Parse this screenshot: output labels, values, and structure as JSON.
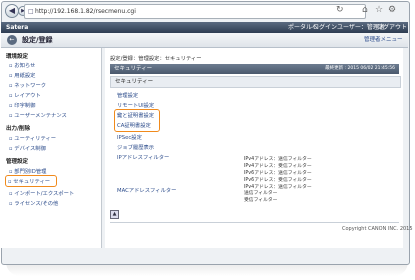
{
  "browser": {
    "url": "http://192.168.1.82/rsecmenu.cgi"
  },
  "topbar": {
    "brand": "Satera",
    "portal": "ポータルへ",
    "login_user": "ログインユーザー：管理者",
    "logout": "ログアウト"
  },
  "pagebar": {
    "title": "設定/登録",
    "admin_menu": "管理者メニュー"
  },
  "sidebar": {
    "section1": "環境設定",
    "items1": [
      "お知らせ",
      "用紙設定",
      "ネットワーク",
      "レイアウト",
      "印字制御",
      "ユーザーメンテナンス"
    ],
    "section2": "出力/削除",
    "items2": [
      "ユーティリティー",
      "デバイス制御"
    ],
    "section3": "管理設定",
    "items3": [
      "部門別ID管理",
      "セキュリティー",
      "インポート/エクスポート",
      "ライセンス/その他"
    ]
  },
  "main": {
    "breadcrumb": "設定/登録：管理設定：セキュリティー",
    "header": "セキュリティー",
    "last_updated": "最終更新 : 2015 06/02 21:45:56",
    "subheader": "セキュリティー",
    "links": [
      "管理設定",
      "リモートUI設定",
      "鍵と証明書設定",
      "CA証明書設定",
      "IPSec設定",
      "ジョブ履歴表示"
    ],
    "ip_filter_label": "IPアドレスフィルター",
    "ip_filter_values": [
      "IPv4アドレス：送信フィルター",
      "IPv4アドレス：受信フィルター",
      "IPv6アドレス：送信フィルター",
      "IPv6アドレス：受信フィルター",
      "IPv4アドレス：送信フィルター"
    ],
    "mac_filter_label": "MACアドレスフィルター",
    "mac_filter_values": [
      "送信フィルター",
      "受信フィルター"
    ],
    "copyright": "Copyright CANON INC. 2015"
  }
}
